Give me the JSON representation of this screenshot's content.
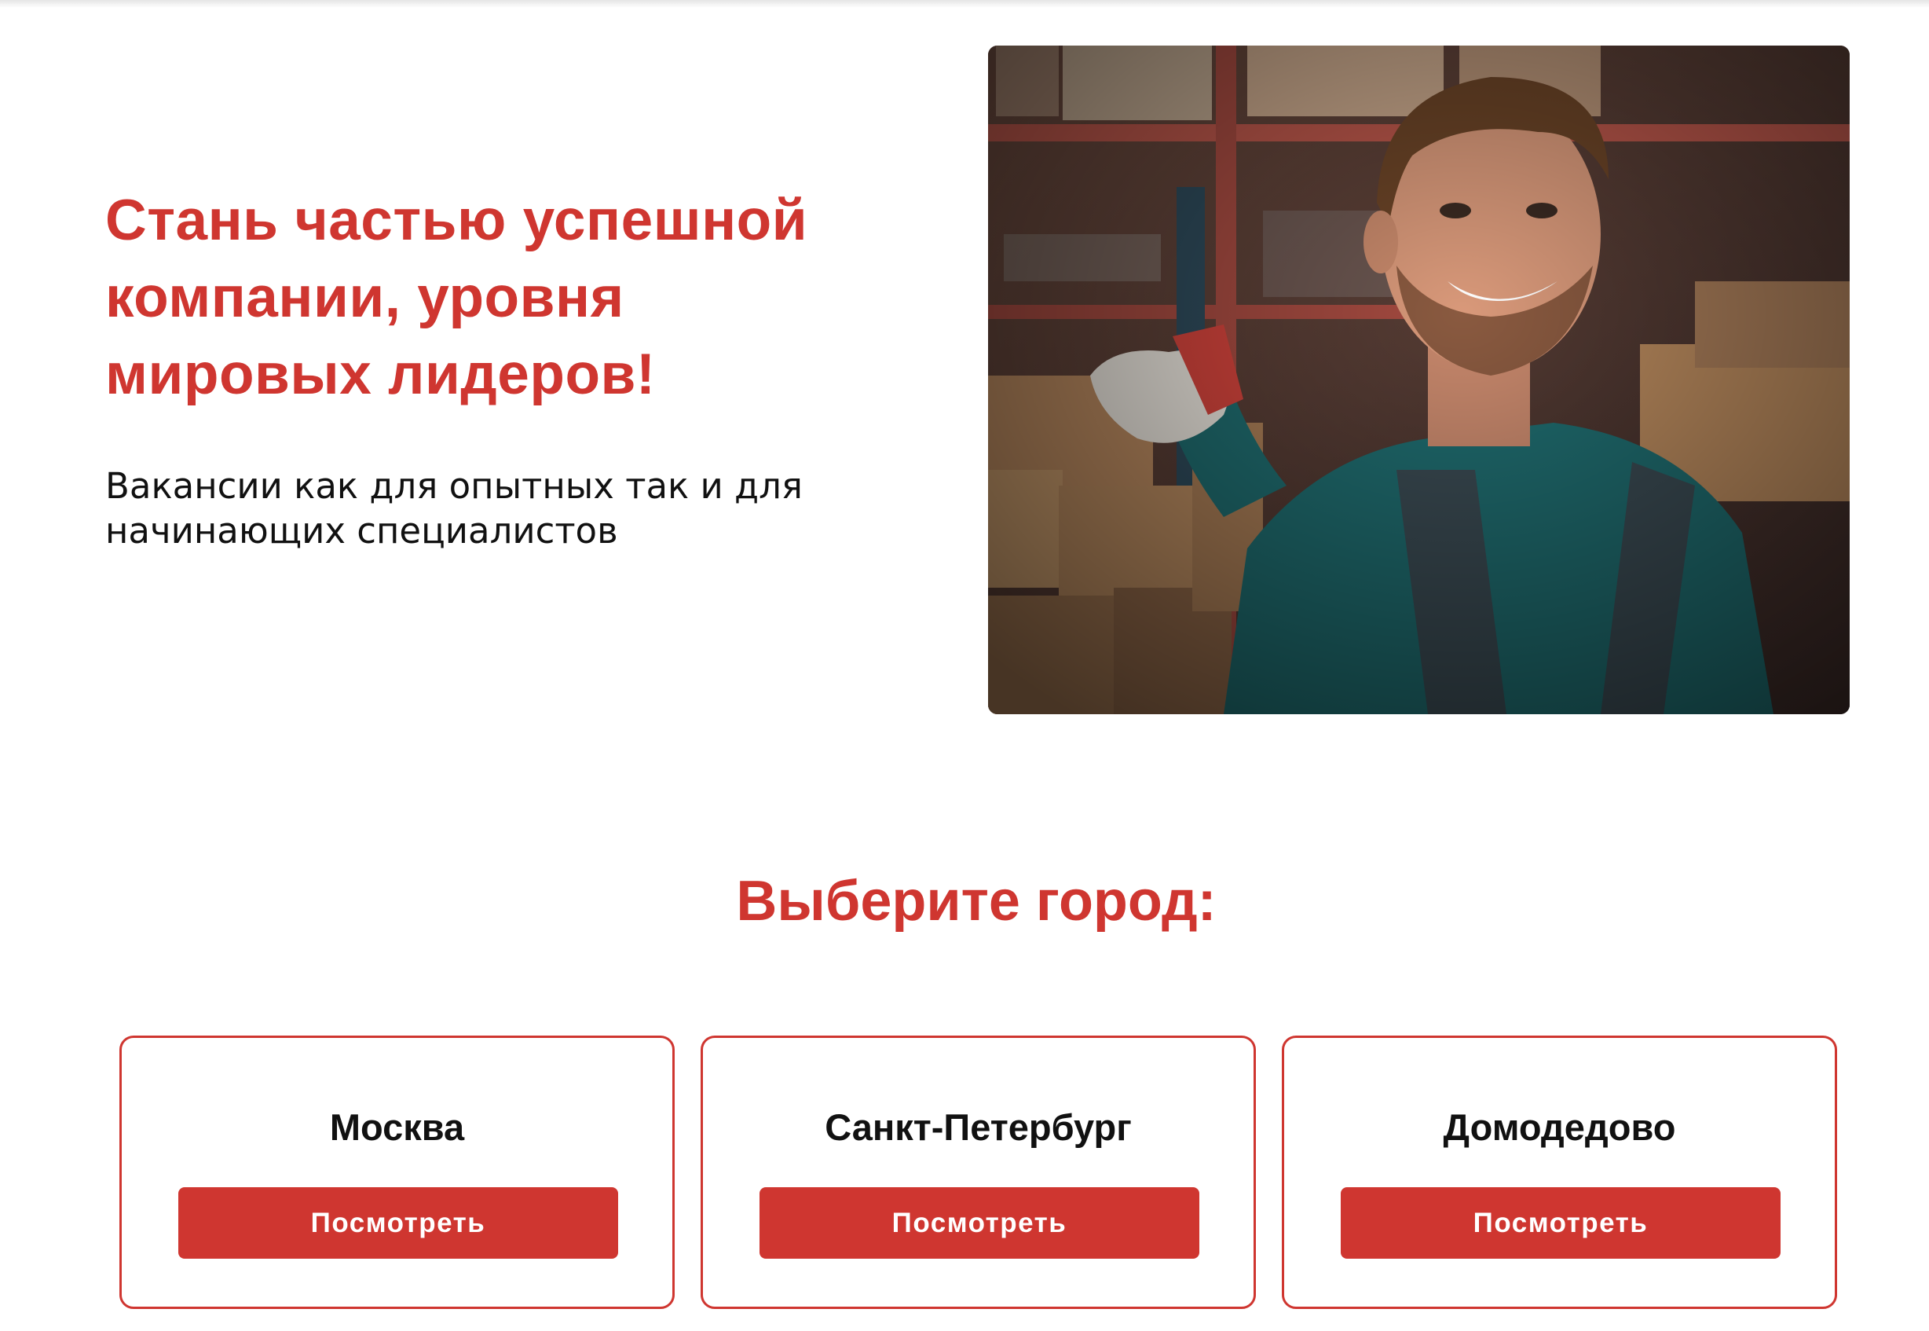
{
  "hero": {
    "title": "Стань частью успешной компании, уровня мировых лидеров!",
    "subtitle": "Вакансии как для опытных так и для начинающих специалистов",
    "photo": "warehouse-worker-photo"
  },
  "cities_section": {
    "title": "Выберите город:",
    "cities": [
      {
        "name": "Москва",
        "button_label": "Посмотреть"
      },
      {
        "name": "Санкт-Петербург",
        "button_label": "Посмотреть"
      },
      {
        "name": "Домодедово",
        "button_label": "Посмотреть"
      }
    ]
  },
  "colors": {
    "accent": "#cf3630",
    "text": "#111111",
    "background": "#ffffff"
  }
}
